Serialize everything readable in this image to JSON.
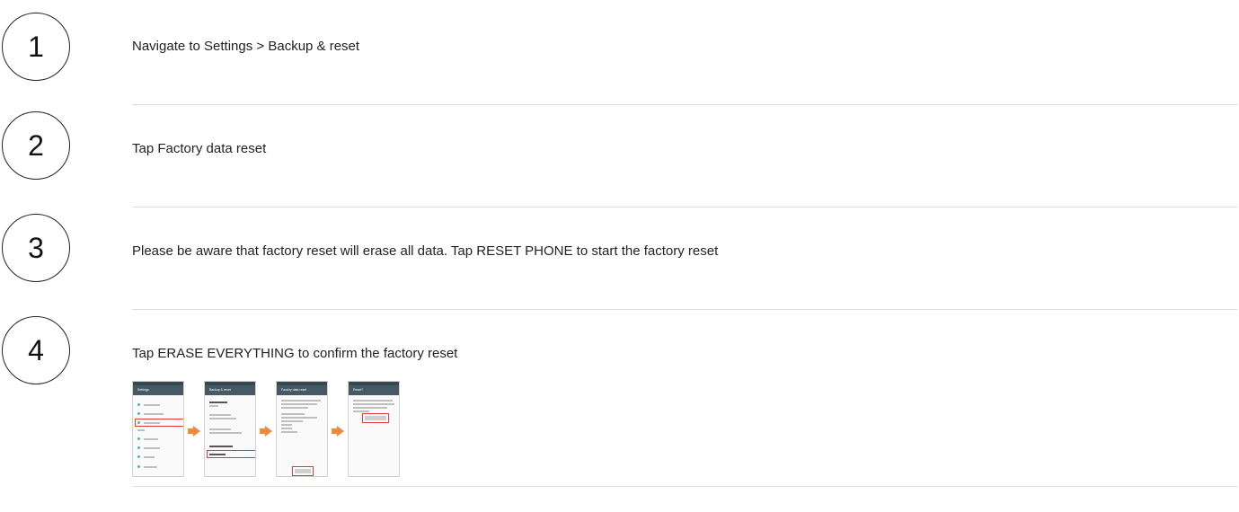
{
  "steps": [
    {
      "number": "1",
      "text": "Navigate to Settings > Backup & reset"
    },
    {
      "number": "2",
      "text": "Tap Factory data reset"
    },
    {
      "number": "3",
      "text": "Please be aware that factory reset will erase all data. Tap RESET PHONE to start the factory reset"
    },
    {
      "number": "4",
      "text": "Tap ERASE EVERYTHING to confirm the factory reset"
    }
  ],
  "thumbnails": {
    "screen1_title": "Settings",
    "screen2_title": "Backup & reset",
    "screen3_title": "Factory data reset",
    "screen4_title": "Reset?",
    "accent_color": "#e53935",
    "arrow_color": "#ef8a3c"
  }
}
